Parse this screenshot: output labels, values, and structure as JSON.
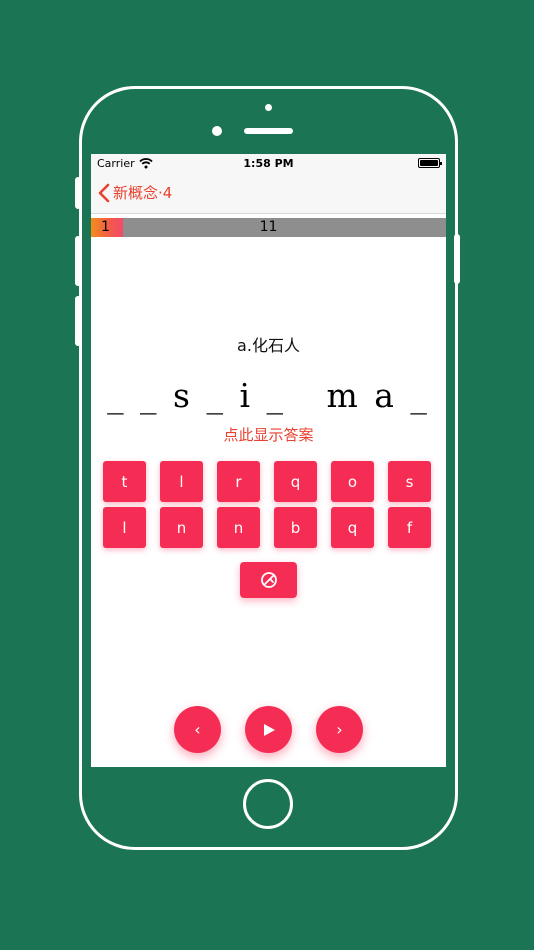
{
  "status": {
    "carrier": "Carrier",
    "time": "1:58 PM"
  },
  "nav": {
    "back_label": "新概念·4"
  },
  "progress": {
    "current": "1",
    "total": "11",
    "fraction": 0.09
  },
  "card": {
    "meaning": "a.化石人",
    "pattern": "__s_i_ ma_",
    "show_answer_label": "点此显示答案"
  },
  "keys": [
    "t",
    "l",
    "r",
    "q",
    "o",
    "s",
    "l",
    "n",
    "n",
    "b",
    "q",
    "f"
  ],
  "controls": {
    "prev_label": "‹",
    "next_label": "›"
  },
  "colors": {
    "background": "#1b7453",
    "accent": "#f52d55",
    "link": "#e8412f",
    "progress_track": "#8e8e8e"
  }
}
